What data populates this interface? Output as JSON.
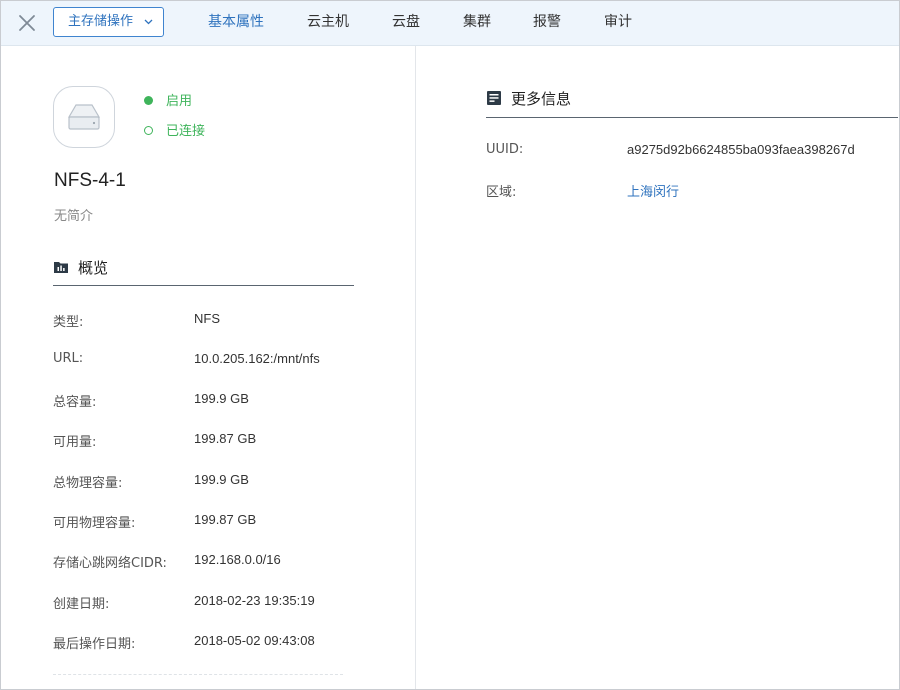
{
  "header": {
    "close_icon": "close-icon",
    "operation_button": "主存储操作",
    "tabs": [
      {
        "label": "基本属性",
        "active": true
      },
      {
        "label": "云主机",
        "active": false
      },
      {
        "label": "云盘",
        "active": false
      },
      {
        "label": "集群",
        "active": false
      },
      {
        "label": "报警",
        "active": false
      },
      {
        "label": "审计",
        "active": false
      }
    ]
  },
  "resource": {
    "icon": "storage-drive-icon",
    "name": "NFS-4-1",
    "description": "无简介",
    "state": "启用",
    "status": "已连接",
    "status_color": "#3fb45b"
  },
  "overview": {
    "title": "概览",
    "icon": "chart-folder-icon",
    "rows": [
      {
        "label": "类型:",
        "value": "NFS"
      },
      {
        "label": "URL:",
        "value": "10.0.205.162:/mnt/nfs"
      },
      {
        "label": "总容量:",
        "value": "199.9 GB"
      },
      {
        "label": "可用量:",
        "value": "199.87 GB"
      },
      {
        "label": "总物理容量:",
        "value": "199.9 GB"
      },
      {
        "label": "可用物理容量:",
        "value": "199.87 GB"
      },
      {
        "label": "存储心跳网络CIDR:",
        "value": "192.168.0.0/16"
      },
      {
        "label": "创建日期:",
        "value": "2018-02-23 19:35:19"
      },
      {
        "label": "最后操作日期:",
        "value": "2018-05-02 09:43:08"
      }
    ]
  },
  "more_info": {
    "title": "更多信息",
    "icon": "document-icon",
    "rows": [
      {
        "label": "UUID:",
        "value": "a9275d92b6624855ba093faea398267d"
      },
      {
        "label": "区域:",
        "value": "上海闵行"
      }
    ]
  },
  "colors": {
    "accent": "#2f73be",
    "success": "#3fb45b",
    "topbar": "#eef5fc"
  }
}
